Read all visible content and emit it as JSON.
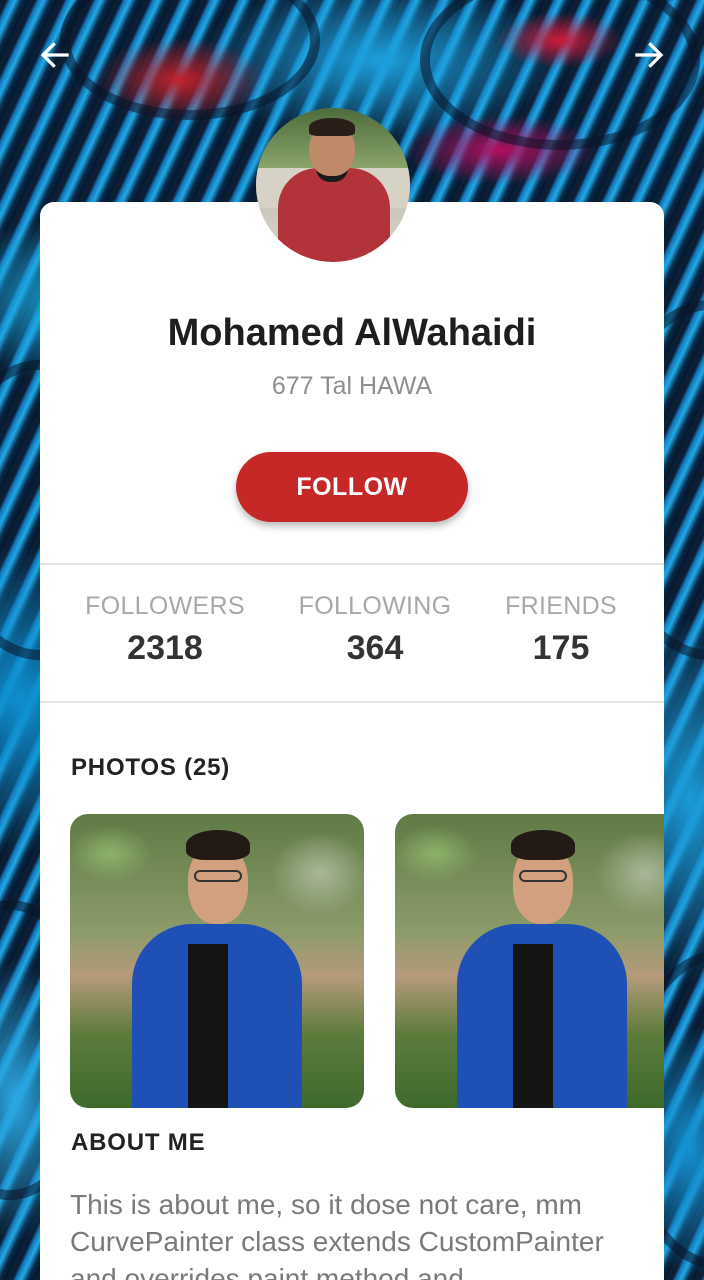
{
  "header": {
    "back_icon": "arrow-left-icon",
    "forward_icon": "arrow-right-icon"
  },
  "profile": {
    "name": "Mohamed AlWahaidi",
    "address": "677 Tal HAWA",
    "follow_label": "FOLLOW"
  },
  "stats": [
    {
      "label": "FOLLOWERS",
      "value": "2318"
    },
    {
      "label": "FOLLOWING",
      "value": "364"
    },
    {
      "label": "FRIENDS",
      "value": "175"
    }
  ],
  "photos": {
    "title": "PHOTOS (25)"
  },
  "about": {
    "title": "ABOUT ME",
    "lines": [
      "This is about me, so it dose not care, mm",
      "CurvePainter class extends CustomPainter",
      "and overrides paint method and"
    ]
  },
  "colors": {
    "accent": "#c62828",
    "card": "#ffffff",
    "label_gray": "#a8a8a8"
  }
}
